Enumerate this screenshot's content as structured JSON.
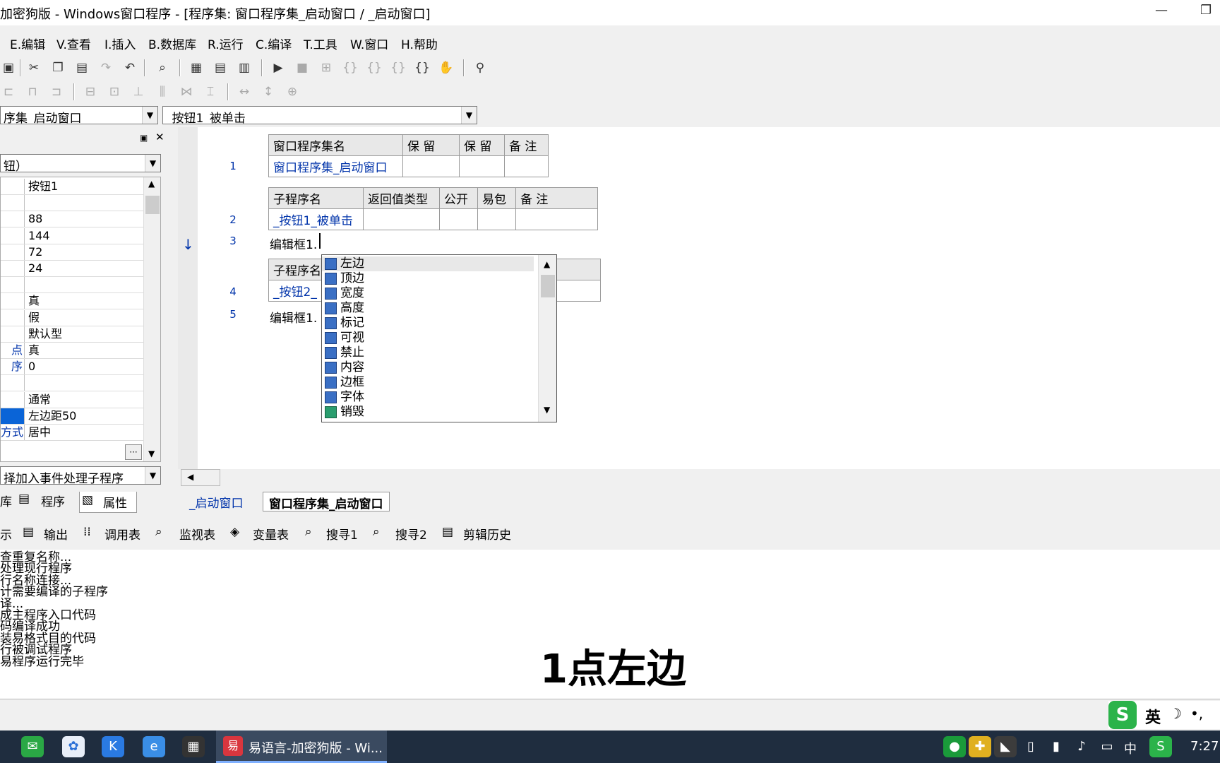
{
  "window": {
    "title": "加密狗版 - Windows窗口程序 - [程序集: 窗口程序集_启动窗口 / _启动窗口]",
    "minimize": "—",
    "restore": "❐"
  },
  "menu": [
    "E.编辑",
    "V.查看",
    "I.插入",
    "B.数据库",
    "R.运行",
    "C.编译",
    "T.工具",
    "W.窗口",
    "H.帮助"
  ],
  "combos": {
    "assembly": "序集_启动窗口",
    "subroutine": "_按钮1_被单击"
  },
  "left_panel": {
    "object_combo": "钮）",
    "properties": [
      {
        "name": "",
        "value": "按钮1"
      },
      {
        "name": "",
        "value": ""
      },
      {
        "name": "",
        "value": "88"
      },
      {
        "name": "",
        "value": "144"
      },
      {
        "name": "",
        "value": "72"
      },
      {
        "name": "",
        "value": "24"
      },
      {
        "name": "",
        "value": ""
      },
      {
        "name": "",
        "value": "真"
      },
      {
        "name": "",
        "value": "假"
      },
      {
        "name": "",
        "value": "默认型"
      },
      {
        "name": "点",
        "value": "真"
      },
      {
        "name": "序",
        "value": "0"
      },
      {
        "name": "",
        "value": ""
      },
      {
        "name": "",
        "value": "通常"
      },
      {
        "name": "",
        "value": "左边距50"
      },
      {
        "name": "方式",
        "value": "居中"
      }
    ],
    "event_combo": "择加入事件处理子程序",
    "tabs": [
      "库",
      "程序",
      "属性"
    ],
    "ellipsis": "···"
  },
  "editor": {
    "line_numbers": [
      "1",
      "2",
      "3",
      "4",
      "5"
    ],
    "table1": {
      "headers": [
        "窗口程序集名",
        "保 留",
        "保 留",
        "备 注"
      ],
      "row": [
        "窗口程序集_启动窗口",
        "",
        "",
        ""
      ]
    },
    "table2": {
      "headers": [
        "子程序名",
        "返回值类型",
        "公开",
        "易包",
        "备 注"
      ],
      "row": [
        "_按钮1_被单击",
        "",
        "",
        "",
        ""
      ]
    },
    "line3": "编辑框1.",
    "table3": {
      "header": "子程序名",
      "row": "_按钮2_"
    },
    "line5": "编辑框1.",
    "arrow": "↓"
  },
  "autocomplete": [
    "左边",
    "顶边",
    "宽度",
    "高度",
    "标记",
    "可视",
    "禁止",
    "内容",
    "边框",
    "字体",
    "销毁"
  ],
  "editor_tabs": [
    "_启动窗口",
    "窗口程序集_启动窗口"
  ],
  "output_tabs": [
    "示",
    "输出",
    "调用表",
    "监视表",
    "变量表",
    "搜寻1",
    "搜寻2",
    "剪辑历史"
  ],
  "output_lines": [
    "查重复名称...",
    "处理现行程序",
    "行名称连接...",
    "计需要编译的子程序",
    "译...",
    "成主程序入口代码",
    "码编译成功",
    "装易格式目的代码",
    "行被调试程序",
    "易程序运行完毕"
  ],
  "caption": "1点左边",
  "ime": {
    "label": "英",
    "moon": "☽",
    "punct": "•,"
  },
  "taskbar": {
    "active_app": "易语言-加密狗版 - Wi...",
    "ime_lang": "中",
    "time": "7:27"
  }
}
